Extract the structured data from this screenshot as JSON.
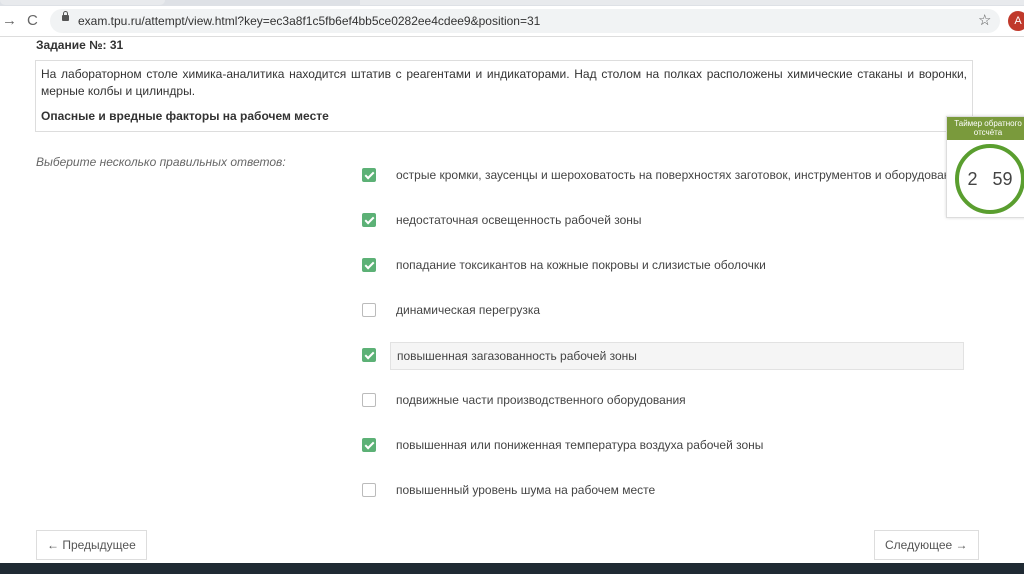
{
  "browser": {
    "url": "exam.tpu.ru/attempt/view.html?key=ec3a8f1c5fb6ef4bb5ce0282ee4cdee9&position=31",
    "avatar": "A",
    "back": "→",
    "reload": "C",
    "star": "☆"
  },
  "task": {
    "title": "Задание №:  31",
    "text": "На лабораторном столе химика-аналитика находится штатив с реагентами и индикаторами. Над столом на полках расположены химические стаканы и воронки, мерные колбы и цилиндры.",
    "question": "Опасные и вредные факторы на рабочем месте"
  },
  "hint": "Выберите несколько правильных ответов:",
  "options": [
    {
      "label": "острые кромки, заусенцы и шероховатость на поверхностях заготовок, инструментов и оборудования",
      "checked": true
    },
    {
      "label": "недостаточная освещенность рабочей зоны",
      "checked": true
    },
    {
      "label": "попадание токсикантов на кожные покровы и слизистые оболочки",
      "checked": true
    },
    {
      "label": "динамическая перегрузка",
      "checked": false
    },
    {
      "label": "повышенная загазованность рабочей зоны",
      "checked": true
    },
    {
      "label": "подвижные части производственного оборудования",
      "checked": false
    },
    {
      "label": "повышенная или пониженная температура воздуха рабочей зоны",
      "checked": true
    },
    {
      "label": "повышенный уровень шума на рабочем месте",
      "checked": false
    }
  ],
  "timer": {
    "title": "Таймер обратного отсчёта",
    "minutes": "2",
    "seconds": "59"
  },
  "nav": {
    "prev": "← Предыдущее",
    "next": "Следующее →"
  }
}
